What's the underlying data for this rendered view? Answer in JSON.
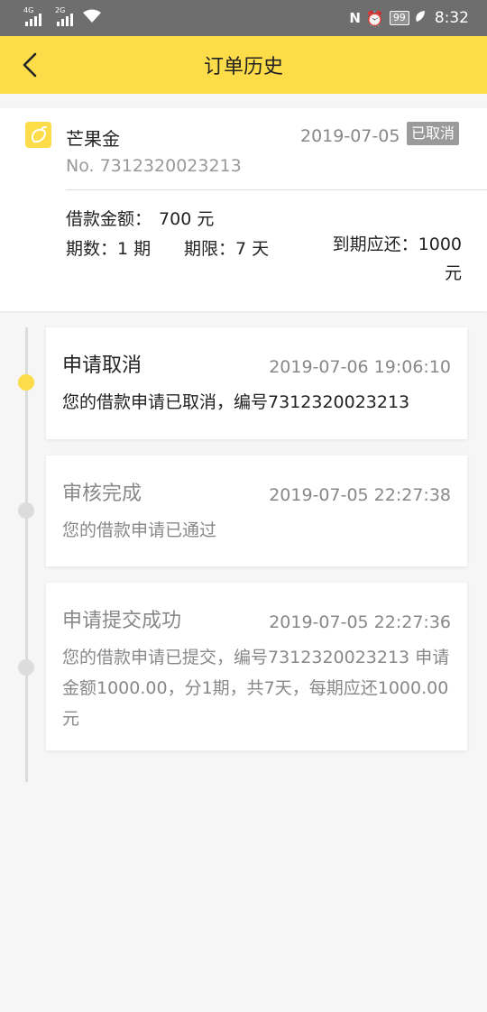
{
  "status_bar": {
    "signal1_label": "4G",
    "signal2_label": "2G",
    "battery": "99",
    "time": "8:32"
  },
  "header": {
    "title": "订单历史",
    "back_icon": "chevron-left-icon"
  },
  "order": {
    "product_name": "芒果金",
    "date": "2019-07-05",
    "status": "已取消",
    "number": "No. 7312320023213",
    "loan_amount_label": "借款金额：",
    "loan_amount_value": "700 元",
    "periods": "期数：1 期",
    "term": "期限：7 天",
    "due_label": "到期应还：1000",
    "due_unit": "元"
  },
  "timeline": [
    {
      "title": "申请取消",
      "time": "2019-07-06 19:06:10",
      "desc": "您的借款申请已取消，编号7312320023213"
    },
    {
      "title": "审核完成",
      "time": "2019-07-05 22:27:38",
      "desc": "您的借款申请已通过"
    },
    {
      "title": "申请提交成功",
      "time": "2019-07-05 22:27:36",
      "desc": "您的借款申请已提交，编号7312320023213 申请金额1000.00，分1期，共7天，每期应还1000.00元"
    }
  ],
  "colors": {
    "accent": "#fddc4a",
    "status_bar": "#6e6e6e",
    "badge": "#9a9a9a"
  }
}
